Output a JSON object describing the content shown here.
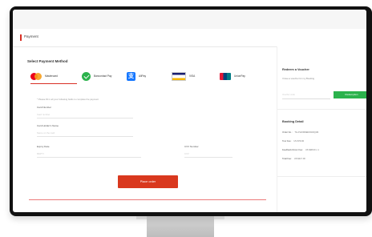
{
  "header": {
    "title": "Payment"
  },
  "payment": {
    "heading": "Select Payment Method",
    "methods": [
      {
        "label": "Mastercard"
      },
      {
        "label": "Bancontact Pay"
      },
      {
        "label": "AliPay"
      },
      {
        "label": "VISA"
      },
      {
        "label": "UnionPay"
      }
    ],
    "hint": "* Please fill in all your following fields to complete the payment",
    "fields": {
      "card_number": {
        "label": "Card Number",
        "placeholder": "Card number"
      },
      "cardholder": {
        "label": "Card Holder's Name",
        "placeholder": "Name on the card"
      },
      "expiry": {
        "label": "Expiry Date",
        "placeholder": "MM/YY"
      },
      "cvv": {
        "label": "CVV Number",
        "placeholder": "CVV"
      }
    },
    "pay_button": "Place order"
  },
  "sidebar": {
    "voucher_heading": "Redeem a Voucher",
    "voucher_text": "I have a voucher for my Booking",
    "voucher_placeholder": "Voucher code",
    "redeem_button": "Redemption",
    "booking_heading": "Booking Detail",
    "rows": [
      {
        "key": "Order No.:",
        "value": "TH-PHORDER2023Q1M"
      },
      {
        "key": "Tour Fee:",
        "value": "US $79.00"
      },
      {
        "key": "Feedback Room Fee:",
        "value": "US $38.00 x 1"
      },
      {
        "key": "Total Fee:",
        "value": "US $117.00"
      }
    ]
  },
  "colors": {
    "accent": "#d9381e",
    "success": "#2bb24c"
  }
}
